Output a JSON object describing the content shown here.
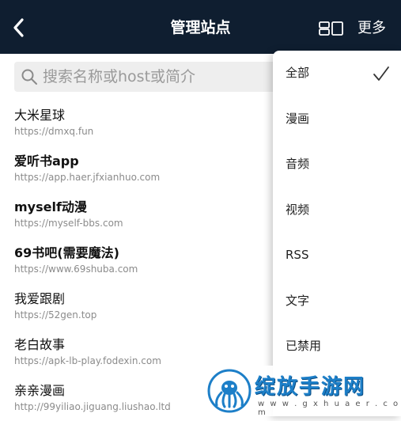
{
  "header": {
    "title": "管理站点",
    "back_icon": "chevron-left-icon",
    "grid_icon": "grid-view-icon",
    "more_label": "更多"
  },
  "search": {
    "placeholder": "搜索名称或host或简介",
    "value": ""
  },
  "sites": [
    {
      "name": "大米星球",
      "url": "https://dmxq.fun"
    },
    {
      "name": "爱听书app",
      "url": "https://app.haer.jfxianhuo.com"
    },
    {
      "name": "myself动漫",
      "url": "https://myself-bbs.com"
    },
    {
      "name": "69书吧(需要魔法)",
      "url": "https://www.69shuba.com"
    },
    {
      "name": "我爱跟剧",
      "url": "https://52gen.top"
    },
    {
      "name": "老白故事",
      "url": "https://apk-lb-play.fodexin.com"
    },
    {
      "name": "亲亲漫画",
      "url": "http://99yiliao.jiguang.liushao.ltd"
    }
  ],
  "menu": {
    "items": [
      "全部",
      "漫画",
      "音频",
      "视频",
      "RSS",
      "文字",
      "已禁用"
    ],
    "selected": "全部",
    "check_icon": "checkmark-icon"
  },
  "watermark": {
    "name": "绽放手游网",
    "url": "w w w . g x h u a e r . c o m"
  },
  "colors": {
    "header_bg": "#0f1e30",
    "watermark_blue": "#1d7fc8"
  }
}
